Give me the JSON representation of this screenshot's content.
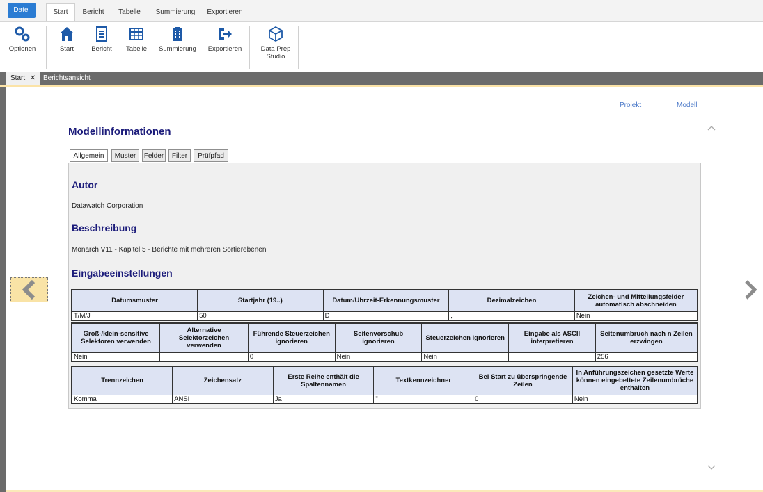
{
  "ribbon_tabs": [
    "Datei",
    "Start",
    "Bericht",
    "Tabelle",
    "Summierung",
    "Exportieren"
  ],
  "ribbon_buttons": {
    "optionen": "Optionen",
    "start": "Start",
    "bericht": "Bericht",
    "tabelle": "Tabelle",
    "summierung": "Summierung",
    "exportieren": "Exportieren",
    "data_prep_line1": "Data Prep",
    "data_prep_line2": "Studio"
  },
  "doc_tabs": {
    "start": "Start",
    "close": "✕",
    "bericht": "Berichtsansicht"
  },
  "links": {
    "projekt": "Projekt",
    "modell": "Modell"
  },
  "title": "Modellinformationen",
  "content_tabs": [
    "Allgemein",
    "Muster",
    "Felder",
    "Filter",
    "Prüfpfad"
  ],
  "sections": {
    "autor_heading": "Autor",
    "autor_value": "Datawatch Corporation",
    "beschreibung_heading": "Beschreibung",
    "beschreibung_value": "Monarch V11 - Kapitel 5 - Berichte mit mehreren Sortierebenen",
    "eingabe_heading": "Eingabeeinstellungen"
  },
  "table1": {
    "headers": [
      "Datumsmuster",
      "Startjahr (19..)",
      "Datum/Uhrzeit-Erkennungsmuster",
      "Dezimalzeichen",
      "Zeichen- und Mitteilungsfelder automatisch abschneiden"
    ],
    "values": [
      "T/M/J",
      "50",
      "D",
      ",",
      "Nein"
    ]
  },
  "table2": {
    "headers": [
      "Groß-/klein-sensitive Selektoren verwenden",
      "Alternative Selektorzeichen verwenden",
      "Führende Steuerzeichen ignorieren",
      "Seitenvorschub ignorieren",
      "Steuerzeichen ignorieren",
      "Eingabe als ASCII interpretieren",
      "Seitenumbruch nach n Zeilen erzwingen"
    ],
    "values": [
      "Nein",
      "",
      "0",
      "Nein",
      "Nein",
      "",
      "256"
    ]
  },
  "table3": {
    "headers": [
      "Trennzeichen",
      "Zeichensatz",
      "Erste Reihe enthält die Spaltennamen",
      "Textkennzeichner",
      "Bei Start zu überspringende Zeilen",
      "In Anführungszeichen gesetzte Werte können eingebettete Zeilenumbrüche enthalten"
    ],
    "values": [
      "Komma",
      "ANSI",
      "Ja",
      "\"",
      "0",
      "Nein"
    ]
  },
  "icons": {
    "optionen": "gears-icon",
    "start": "home-icon",
    "bericht": "document-icon",
    "tabelle": "table-icon",
    "summierung": "building-icon",
    "exportieren": "export-icon",
    "data_prep": "cube-icon",
    "nav_prev": "chevron-left-icon",
    "nav_next": "chevron-right-icon"
  },
  "colors": {
    "file_tab": "#2b7cd3",
    "heading": "#1b1b7a",
    "table_header": "#dde3f3",
    "link": "#4a78c8",
    "accent": "#fbe3a7"
  }
}
